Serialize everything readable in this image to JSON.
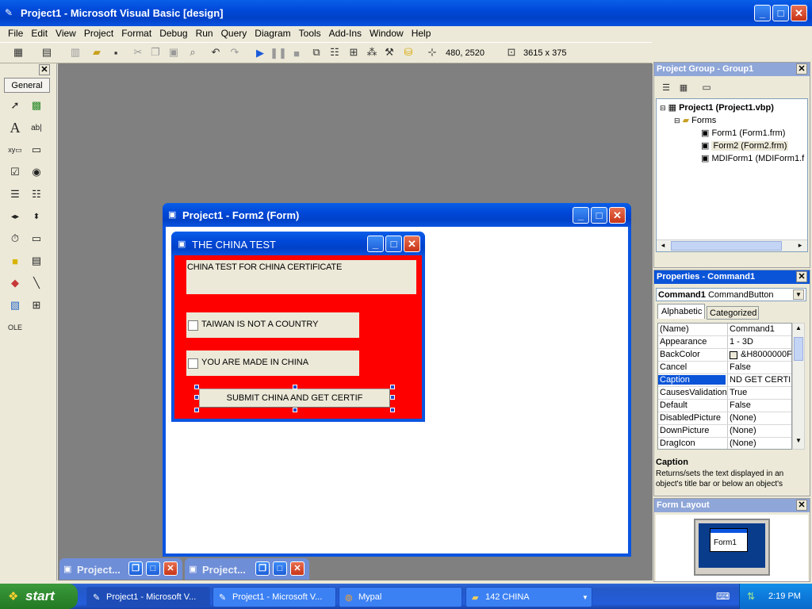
{
  "app": {
    "title": "Project1 - Microsoft Visual Basic [design]"
  },
  "menu": [
    "File",
    "Edit",
    "View",
    "Project",
    "Format",
    "Debug",
    "Run",
    "Query",
    "Diagram",
    "Tools",
    "Add-Ins",
    "Window",
    "Help"
  ],
  "toolbar": {
    "position_readout": "480, 2520",
    "size_readout": "3615 x 375"
  },
  "toolbox": {
    "tab_label": "General"
  },
  "form2_window": {
    "title": "Project1 - Form2 (Form)"
  },
  "china_form": {
    "title": "THE CHINA TEST",
    "label_text": "CHINA TEST FOR CHINA CERTIFICATE",
    "check1_label": "TAIWAN IS NOT A COUNTRY",
    "check2_label": "YOU ARE MADE IN CHINA",
    "button_label": "SUBMIT CHINA AND GET CERTIF",
    "bg_color": "#FF0000"
  },
  "project_group": {
    "title": "Project Group - Group1",
    "tree": [
      {
        "label": "Project1 (Project1.vbp)"
      },
      {
        "label": "Forms"
      },
      {
        "label": "Form1 (Form1.frm)"
      },
      {
        "label": "Form2 (Form2.frm)"
      },
      {
        "label": "MDIForm1 (MDIForm1.f"
      }
    ]
  },
  "properties": {
    "title": "Properties - Command1",
    "object_name": "Command1",
    "object_type": "CommandButton",
    "tabs": [
      "Alphabetic",
      "Categorized"
    ],
    "rows": [
      {
        "name": "(Name)",
        "value": "Command1"
      },
      {
        "name": "Appearance",
        "value": "1 - 3D"
      },
      {
        "name": "BackColor",
        "value": "&H8000000F"
      },
      {
        "name": "Cancel",
        "value": "False"
      },
      {
        "name": "Caption",
        "value": "ND GET CERTIF"
      },
      {
        "name": "CausesValidation",
        "value": "True"
      },
      {
        "name": "Default",
        "value": "False"
      },
      {
        "name": "DisabledPicture",
        "value": "(None)"
      },
      {
        "name": "DownPicture",
        "value": "(None)"
      },
      {
        "name": "DragIcon",
        "value": "(None)"
      }
    ],
    "desc_title": "Caption",
    "desc_text": "Returns/sets the text displayed in an object's title bar or below an object's"
  },
  "form_layout": {
    "title": "Form Layout",
    "mini_label": "Form1"
  },
  "mdi_min": [
    {
      "label": "Project..."
    },
    {
      "label": "Project..."
    }
  ],
  "taskbar": {
    "start_label": "start",
    "items": [
      {
        "label": "Project1 - Microsoft V..."
      },
      {
        "label": "Project1 - Microsoft V..."
      },
      {
        "label": "Mypal"
      },
      {
        "label": "142 CHINA"
      }
    ],
    "clock": "2:19 PM"
  }
}
